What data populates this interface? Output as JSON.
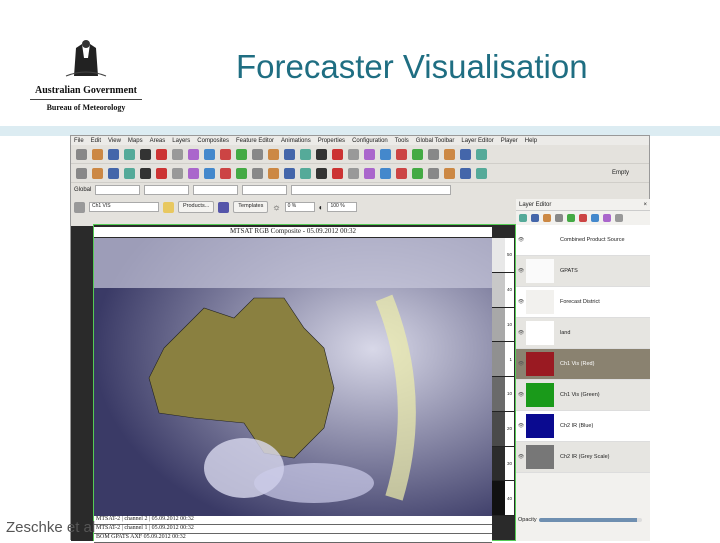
{
  "slide": {
    "title": "Forecaster Visualisation",
    "logo_line1": "Australian Government",
    "logo_line2": "Bureau of Meteorology",
    "credit": "Zeschke et al"
  },
  "app": {
    "menu": [
      "File",
      "Edit",
      "View",
      "Maps",
      "Areas",
      "Layers",
      "Composites",
      "Feature Editor",
      "Animations",
      "Properties",
      "Configuration",
      "Tools",
      "Global Toolbar",
      "Layer Editor",
      "Player",
      "Help"
    ],
    "toolbar2": {
      "empty_label": "Empty"
    },
    "toolbar3": {
      "global_label": "Global"
    },
    "toolbar4": {
      "channel": "Ch1 VIS",
      "products": "Products...",
      "templates": "Templates",
      "brightness": "0 %",
      "contrast": "100 %"
    },
    "map": {
      "title": "MTSAT RGB Composite - 05.09.2012 00:32",
      "scale_labels": [
        "50",
        "40",
        "10",
        "1",
        "10",
        "20",
        "30",
        "40"
      ],
      "captions": [
        "MTSAT-2 | channel 2 | 05.09.2012 00:32",
        "MTSAT-2 | channel 1 | 05.09.2012 00:32",
        "BOM GPATS AXF 05.09.2012 00:32"
      ]
    },
    "layer_editor": {
      "title": "Layer Editor",
      "opacity_label": "Opacity",
      "opacity": 0.95,
      "layers": [
        {
          "name": "Combined Product Source",
          "thumb": "#ffffff"
        },
        {
          "name": "GPATS",
          "thumb": "#fafafa"
        },
        {
          "name": "Forecast District",
          "thumb": "#f2f1ee"
        },
        {
          "name": "land",
          "thumb": "#ffffff"
        },
        {
          "name": "Ch1 Vis (Red)",
          "thumb": "#9a1a22",
          "selected": true
        },
        {
          "name": "Ch1 Vis (Green)",
          "thumb": "#1a9a1a"
        },
        {
          "name": "Ch2 IR (Blue)",
          "thumb": "#0a0a90"
        },
        {
          "name": "Ch2 IR (Grey Scale)",
          "thumb": "#777777"
        }
      ]
    }
  }
}
